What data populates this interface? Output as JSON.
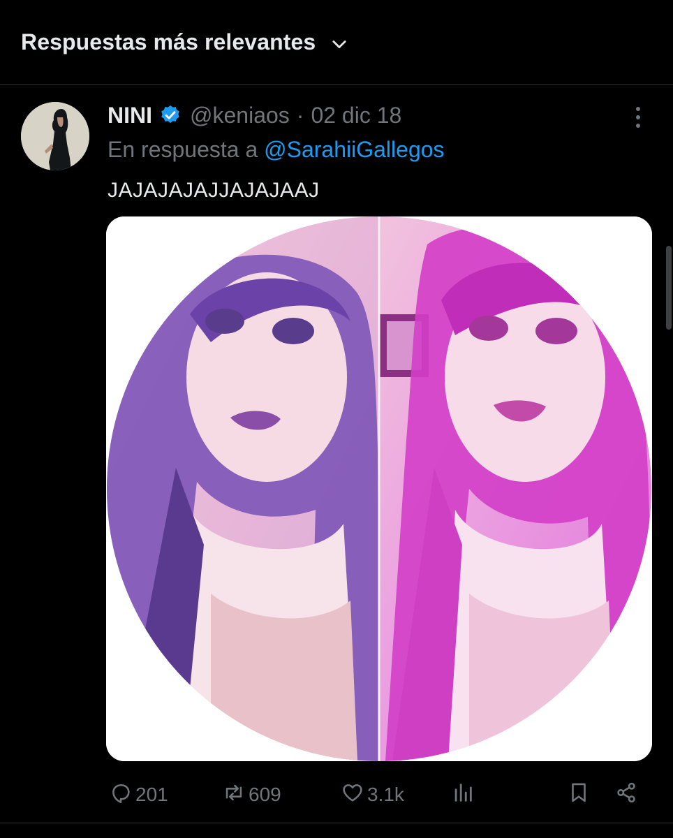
{
  "header": {
    "sort_label": "Respuestas más relevantes"
  },
  "tweet": {
    "display_name": "NINI",
    "handle": "@keniaos",
    "separator": "·",
    "date": "02 dic 18",
    "reply_prefix": "En respuesta a ",
    "reply_mention": "@SarahiiGallegos",
    "text": "JAJAJAJAJJAJAJAAJ",
    "verified": true
  },
  "actions": {
    "replies": "201",
    "retweets": "609",
    "likes": "3.1k"
  },
  "colors": {
    "background": "#000000",
    "text_primary": "#e7e9ea",
    "text_secondary": "#71767b",
    "link": "#1d9bf0",
    "verified_badge": "#1d9bf0",
    "divider": "#2f3336"
  },
  "icons": [
    "chevron-down-icon",
    "verified-icon",
    "more-icon",
    "reply-icon",
    "retweet-icon",
    "like-icon",
    "views-icon",
    "bookmark-icon",
    "share-icon"
  ]
}
